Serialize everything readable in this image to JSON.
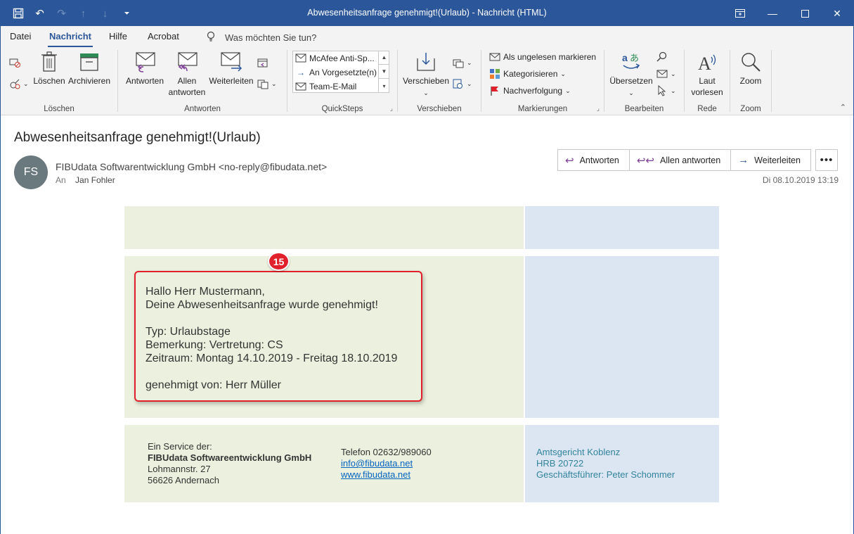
{
  "titlebar": {
    "title": "Abwesenheitsanfrage genehmigt!(Urlaub)  -  Nachricht (HTML)"
  },
  "menu": {
    "tabs": [
      "Datei",
      "Nachricht",
      "Hilfe",
      "Acrobat"
    ],
    "active_tab": "Nachricht",
    "tell_me": "Was möchten Sie tun?"
  },
  "ribbon": {
    "groups": {
      "loeschen": {
        "label": "Löschen",
        "delete": "Löschen",
        "archive": "Archivieren"
      },
      "antworten": {
        "label": "Antworten",
        "reply": "Antworten",
        "reply_all_1": "Allen",
        "reply_all_2": "antworten",
        "forward": "Weiterleiten"
      },
      "quicksteps": {
        "label": "QuickSteps",
        "items": [
          "McAfee Anti-Sp...",
          "An Vorgesetzte(n)",
          "Team-E-Mail"
        ]
      },
      "verschieben": {
        "label": "Verschieben",
        "move": "Verschieben"
      },
      "markierungen": {
        "label": "Markierungen",
        "unread": "Als ungelesen markieren",
        "categorize": "Kategorisieren",
        "followup": "Nachverfolgung"
      },
      "bearbeiten": {
        "label": "Bearbeiten",
        "translate": "Übersetzen"
      },
      "rede": {
        "label": "Rede",
        "read_1": "Laut",
        "read_2": "vorlesen"
      },
      "zoom": {
        "label": "Zoom",
        "zoom": "Zoom"
      }
    }
  },
  "message": {
    "subject": "Abwesenheitsanfrage genehmigt!(Urlaub)",
    "avatar_initials": "FS",
    "sender": "FIBUdata Softwarentwicklung GmbH <no-reply@fibudata.net>",
    "to_label": "An",
    "to": "Jan Fohler",
    "date": "Di 08.10.2019 13:19",
    "actions": {
      "reply": "Antworten",
      "reply_all": "Allen antworten",
      "forward": "Weiterleiten"
    }
  },
  "email_body": {
    "greeting": "Hallo Herr Mustermann,",
    "line1": "Deine Abwesenheitsanfrage wurde genehmigt!",
    "type": "Typ: Urlaubstage",
    "remark": "Bemerkung: Vertretung: CS",
    "period": "Zeitraum: Montag 14.10.2019 - Freitag 18.10.2019",
    "approved_by": "genehmigt von: Herr Müller",
    "callout_number": "15"
  },
  "footer": {
    "service": "Ein Service der:",
    "company": "FIBUdata Softwareentwicklung GmbH",
    "street": "Lohmannstr. 27",
    "city": "56626 Andernach",
    "phone": "Telefon 02632/989060",
    "email": "info@fibudata.net",
    "web": "www.fibudata.net",
    "court": "Amtsgericht Koblenz",
    "hrb": "HRB 20722",
    "ceo": "Geschäftsführer: Peter Schommer"
  },
  "colors": {
    "titlebar": "#2b579a",
    "green_cell": "#ebf1de",
    "blue_cell": "#dce6f2",
    "callout": "#e0202a",
    "link": "#0563c1",
    "teal_text": "#31849b"
  }
}
